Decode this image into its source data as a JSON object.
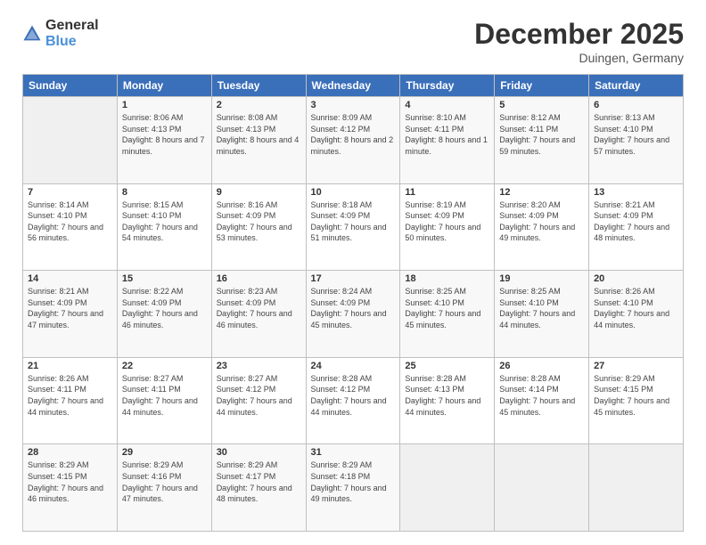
{
  "logo": {
    "general": "General",
    "blue": "Blue"
  },
  "header": {
    "month": "December 2025",
    "location": "Duingen, Germany"
  },
  "days": [
    "Sunday",
    "Monday",
    "Tuesday",
    "Wednesday",
    "Thursday",
    "Friday",
    "Saturday"
  ],
  "weeks": [
    [
      {
        "day": "",
        "sunrise": "",
        "sunset": "",
        "daylight": ""
      },
      {
        "day": "1",
        "sunrise": "Sunrise: 8:06 AM",
        "sunset": "Sunset: 4:13 PM",
        "daylight": "Daylight: 8 hours and 7 minutes."
      },
      {
        "day": "2",
        "sunrise": "Sunrise: 8:08 AM",
        "sunset": "Sunset: 4:13 PM",
        "daylight": "Daylight: 8 hours and 4 minutes."
      },
      {
        "day": "3",
        "sunrise": "Sunrise: 8:09 AM",
        "sunset": "Sunset: 4:12 PM",
        "daylight": "Daylight: 8 hours and 2 minutes."
      },
      {
        "day": "4",
        "sunrise": "Sunrise: 8:10 AM",
        "sunset": "Sunset: 4:11 PM",
        "daylight": "Daylight: 8 hours and 1 minute."
      },
      {
        "day": "5",
        "sunrise": "Sunrise: 8:12 AM",
        "sunset": "Sunset: 4:11 PM",
        "daylight": "Daylight: 7 hours and 59 minutes."
      },
      {
        "day": "6",
        "sunrise": "Sunrise: 8:13 AM",
        "sunset": "Sunset: 4:10 PM",
        "daylight": "Daylight: 7 hours and 57 minutes."
      }
    ],
    [
      {
        "day": "7",
        "sunrise": "Sunrise: 8:14 AM",
        "sunset": "Sunset: 4:10 PM",
        "daylight": "Daylight: 7 hours and 56 minutes."
      },
      {
        "day": "8",
        "sunrise": "Sunrise: 8:15 AM",
        "sunset": "Sunset: 4:10 PM",
        "daylight": "Daylight: 7 hours and 54 minutes."
      },
      {
        "day": "9",
        "sunrise": "Sunrise: 8:16 AM",
        "sunset": "Sunset: 4:09 PM",
        "daylight": "Daylight: 7 hours and 53 minutes."
      },
      {
        "day": "10",
        "sunrise": "Sunrise: 8:18 AM",
        "sunset": "Sunset: 4:09 PM",
        "daylight": "Daylight: 7 hours and 51 minutes."
      },
      {
        "day": "11",
        "sunrise": "Sunrise: 8:19 AM",
        "sunset": "Sunset: 4:09 PM",
        "daylight": "Daylight: 7 hours and 50 minutes."
      },
      {
        "day": "12",
        "sunrise": "Sunrise: 8:20 AM",
        "sunset": "Sunset: 4:09 PM",
        "daylight": "Daylight: 7 hours and 49 minutes."
      },
      {
        "day": "13",
        "sunrise": "Sunrise: 8:21 AM",
        "sunset": "Sunset: 4:09 PM",
        "daylight": "Daylight: 7 hours and 48 minutes."
      }
    ],
    [
      {
        "day": "14",
        "sunrise": "Sunrise: 8:21 AM",
        "sunset": "Sunset: 4:09 PM",
        "daylight": "Daylight: 7 hours and 47 minutes."
      },
      {
        "day": "15",
        "sunrise": "Sunrise: 8:22 AM",
        "sunset": "Sunset: 4:09 PM",
        "daylight": "Daylight: 7 hours and 46 minutes."
      },
      {
        "day": "16",
        "sunrise": "Sunrise: 8:23 AM",
        "sunset": "Sunset: 4:09 PM",
        "daylight": "Daylight: 7 hours and 46 minutes."
      },
      {
        "day": "17",
        "sunrise": "Sunrise: 8:24 AM",
        "sunset": "Sunset: 4:09 PM",
        "daylight": "Daylight: 7 hours and 45 minutes."
      },
      {
        "day": "18",
        "sunrise": "Sunrise: 8:25 AM",
        "sunset": "Sunset: 4:10 PM",
        "daylight": "Daylight: 7 hours and 45 minutes."
      },
      {
        "day": "19",
        "sunrise": "Sunrise: 8:25 AM",
        "sunset": "Sunset: 4:10 PM",
        "daylight": "Daylight: 7 hours and 44 minutes."
      },
      {
        "day": "20",
        "sunrise": "Sunrise: 8:26 AM",
        "sunset": "Sunset: 4:10 PM",
        "daylight": "Daylight: 7 hours and 44 minutes."
      }
    ],
    [
      {
        "day": "21",
        "sunrise": "Sunrise: 8:26 AM",
        "sunset": "Sunset: 4:11 PM",
        "daylight": "Daylight: 7 hours and 44 minutes."
      },
      {
        "day": "22",
        "sunrise": "Sunrise: 8:27 AM",
        "sunset": "Sunset: 4:11 PM",
        "daylight": "Daylight: 7 hours and 44 minutes."
      },
      {
        "day": "23",
        "sunrise": "Sunrise: 8:27 AM",
        "sunset": "Sunset: 4:12 PM",
        "daylight": "Daylight: 7 hours and 44 minutes."
      },
      {
        "day": "24",
        "sunrise": "Sunrise: 8:28 AM",
        "sunset": "Sunset: 4:12 PM",
        "daylight": "Daylight: 7 hours and 44 minutes."
      },
      {
        "day": "25",
        "sunrise": "Sunrise: 8:28 AM",
        "sunset": "Sunset: 4:13 PM",
        "daylight": "Daylight: 7 hours and 44 minutes."
      },
      {
        "day": "26",
        "sunrise": "Sunrise: 8:28 AM",
        "sunset": "Sunset: 4:14 PM",
        "daylight": "Daylight: 7 hours and 45 minutes."
      },
      {
        "day": "27",
        "sunrise": "Sunrise: 8:29 AM",
        "sunset": "Sunset: 4:15 PM",
        "daylight": "Daylight: 7 hours and 45 minutes."
      }
    ],
    [
      {
        "day": "28",
        "sunrise": "Sunrise: 8:29 AM",
        "sunset": "Sunset: 4:15 PM",
        "daylight": "Daylight: 7 hours and 46 minutes."
      },
      {
        "day": "29",
        "sunrise": "Sunrise: 8:29 AM",
        "sunset": "Sunset: 4:16 PM",
        "daylight": "Daylight: 7 hours and 47 minutes."
      },
      {
        "day": "30",
        "sunrise": "Sunrise: 8:29 AM",
        "sunset": "Sunset: 4:17 PM",
        "daylight": "Daylight: 7 hours and 48 minutes."
      },
      {
        "day": "31",
        "sunrise": "Sunrise: 8:29 AM",
        "sunset": "Sunset: 4:18 PM",
        "daylight": "Daylight: 7 hours and 49 minutes."
      },
      {
        "day": "",
        "sunrise": "",
        "sunset": "",
        "daylight": ""
      },
      {
        "day": "",
        "sunrise": "",
        "sunset": "",
        "daylight": ""
      },
      {
        "day": "",
        "sunrise": "",
        "sunset": "",
        "daylight": ""
      }
    ]
  ]
}
